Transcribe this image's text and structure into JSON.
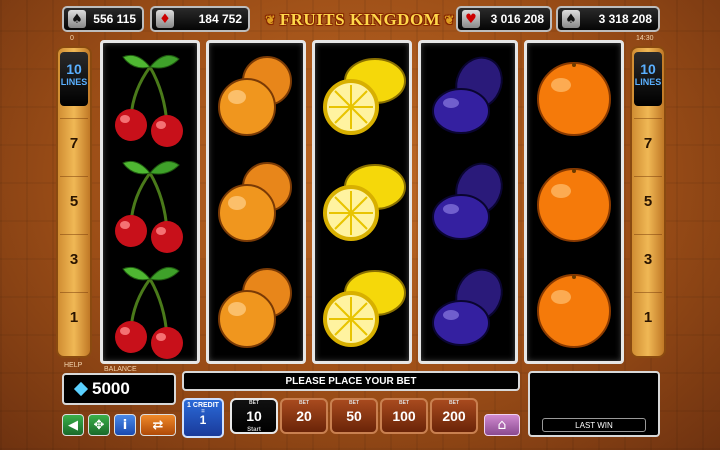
{
  "header": {
    "title": "FRUITS KINGDOM",
    "jackpots": [
      {
        "suit": "spade",
        "glyph": "♠",
        "value": "556 115"
      },
      {
        "suit": "diamond",
        "glyph": "♦",
        "value": "184 752"
      },
      {
        "suit": "heart",
        "glyph": "♥",
        "value": "3 016 208"
      },
      {
        "suit": "club-spade",
        "glyph": "♠",
        "value": "3 318 208"
      }
    ],
    "top_left_index": "0",
    "clock": "14:30"
  },
  "lines_panel": {
    "count": "10",
    "label": "LINES",
    "numbers": [
      "7",
      "5",
      "3",
      "1"
    ],
    "help_label": "HELP"
  },
  "reels": [
    {
      "symbol": "cherry",
      "rows": 3
    },
    {
      "symbol": "apricot",
      "rows": 3
    },
    {
      "symbol": "lemon",
      "rows": 3
    },
    {
      "symbol": "plum",
      "rows": 3
    },
    {
      "symbol": "orange",
      "rows": 3
    }
  ],
  "balance": {
    "label": "BALANCE",
    "value": "5000"
  },
  "message": "PLEASE PLACE YOUR BET",
  "last_win_label": "LAST WIN",
  "credit": {
    "label": "1 CREDIT",
    "eq": "=",
    "value": "1"
  },
  "bets": {
    "caption": "BET",
    "start_label": "Start",
    "options": [
      "10",
      "20",
      "50",
      "100",
      "200"
    ],
    "selected": "10"
  },
  "left_buttons": [
    {
      "name": "sound-icon",
      "glyph": "◀"
    },
    {
      "name": "fullscreen-icon",
      "glyph": "✥"
    },
    {
      "name": "info-icon",
      "glyph": "i"
    },
    {
      "name": "gamble-icon",
      "glyph": "⇄"
    }
  ],
  "home_glyph": "⌂",
  "colors": {
    "accent_gold": "#ffd84a",
    "reel_bg": "#000000",
    "bet_button": "#8a3412",
    "credit_button": "#2a5ac8",
    "lines_text": "#5ab0ff"
  }
}
